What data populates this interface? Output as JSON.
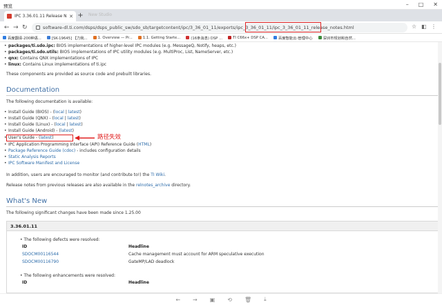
{
  "window": {
    "title": "预览"
  },
  "tab": {
    "title": "IPC 3.36.01.11 Release Notes",
    "ghost": "New Studio"
  },
  "address": {
    "url": "software-dl.ti.com/dsps/dsps_public_sw/sdo_sb/targetcontent/ipc/3_36_01_11/exports/ipc_3_36_01_11/ipc_3_36_01_11_release_notes.html"
  },
  "bookmarks": [
    {
      "label": "百度翻译-200种语...",
      "color": "#2f7de1"
    },
    {
      "label": "[SK-19645] 【力我...",
      "color": "#3a7bd5"
    },
    {
      "label": "1. Overview — Pr...",
      "color": "#e07020"
    },
    {
      "label": "1.1. Getting Starte...",
      "color": "#e07020"
    },
    {
      "label": "(16条消息) DSP ...",
      "color": "#d03030"
    },
    {
      "label": "TI C66x+ DSP CA...",
      "color": "#c02020"
    },
    {
      "label": "百度智能云-管理中心",
      "color": "#2f7de1"
    },
    {
      "label": "深圳市规划和自然...",
      "color": "#3a8a3a"
    }
  ],
  "top_items": [
    {
      "bold": "packages/ti.sdo.ipc:",
      "text": " BIOS implementations of higher-level IPC modules (e.g. MessageQ, Notify, heaps, etc.)"
    },
    {
      "bold": "packages/ti.sdo.utils:",
      "text": " BIOS implementations of IPC utility modules (e.g. MultiProc, List, NameServer, etc.)"
    },
    {
      "bold": "qnx:",
      "text": " Contains QNX implementations of IPC"
    },
    {
      "bold": "linux:",
      "text": " Contains Linux implementations of ti.ipc"
    }
  ],
  "top_para": "These components are provided as source code and prebuilt libraries.",
  "doc": {
    "heading": "Documentation",
    "intro": "The following documentation is available:",
    "items": [
      {
        "pre": "Install Guide (BIOS) - (",
        "l1": "local",
        "sep": " | ",
        "l2": "latest",
        "post": ")"
      },
      {
        "pre": "Install Guide (QNX) - (",
        "l1": "local",
        "sep": " | ",
        "l2": "latest",
        "post": ")"
      },
      {
        "pre": "Install Guide (Linux) - (",
        "l1": "local",
        "sep": " | ",
        "l2": "latest",
        "post": ")"
      },
      {
        "pre": "Install Guide (Android) - (",
        "l1": "",
        "sep": "",
        "l2": "latest",
        "post": ")"
      },
      {
        "pre": "User's Guide - (",
        "l1": "",
        "sep": "",
        "l2": "latest",
        "post": ")"
      }
    ],
    "api_pre": "IPC Application Programming Interface (API) Reference Guide (",
    "api_link": "HTML",
    "api_post": ")",
    "pkg_link": "Package Reference Guide (cdoc)",
    "pkg_post": " - includes configuration details",
    "static_link": "Static Analysis Reports",
    "manifest_link": "IPC Software Manifest and License",
    "wiki_pre": "In addition, users are encouraged to monitor (and contribute to!) the ",
    "wiki_link": "TI Wiki",
    "wiki_post": ".",
    "prev_pre": "Release notes from previous releases are also available in the ",
    "prev_link": "relnotes_archive",
    "prev_post": " directory.",
    "annotation": "路径失效"
  },
  "whatsnew": {
    "heading": "What's New",
    "intro": "The following significant changes have been made since 1.25.00",
    "release": "3.36.01.11",
    "defects_intro": "The following defects were resolved:",
    "col_id": "ID",
    "col_headline": "Headline",
    "defects": [
      {
        "id": "SDOCM00116544",
        "headline": "Cache management must account for ARM speculative execution"
      },
      {
        "id": "SDOCM00116790",
        "headline": "GateMP/LAD deadlock"
      }
    ],
    "enh_intro": "The following enhancements were resolved:",
    "col_id2": "ID",
    "col_headline2": "Headline"
  },
  "colors": {
    "link": "#2a6aa9",
    "heading": "#3f6fa5",
    "annotation": "#e02020"
  }
}
